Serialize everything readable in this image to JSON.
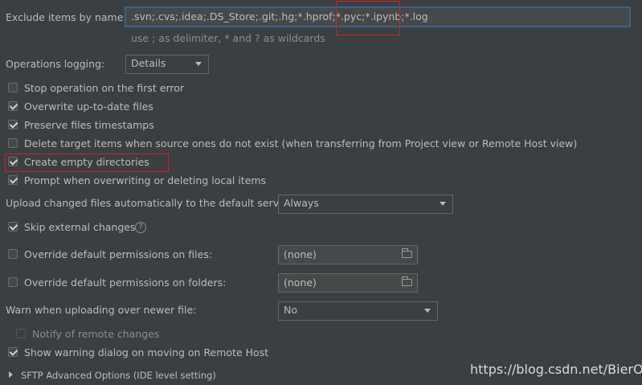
{
  "exclude": {
    "label": "Exclude items by name:",
    "value": ".svn;.cvs;.idea;.DS_Store;.git;.hg;*.hprof;*.pyc;*.ipynb;*.log",
    "hint": "use ; as delimiter, * and ? as wildcards"
  },
  "operations_logging": {
    "label": "Operations logging:",
    "value": "Details"
  },
  "options": {
    "stop_on_error": {
      "label": "Stop operation on the first error",
      "checked": false
    },
    "overwrite_up_to_date": {
      "label": "Overwrite up-to-date files",
      "checked": true
    },
    "preserve_timestamps": {
      "label": "Preserve files timestamps",
      "checked": true
    },
    "delete_target_items": {
      "label": "Delete target items when source ones do not exist (when transferring from Project view or Remote Host view)",
      "checked": false
    },
    "create_empty_dirs": {
      "label": "Create empty directories",
      "checked": true
    },
    "prompt_when_overwriting": {
      "label": "Prompt when overwriting or deleting local items",
      "checked": true
    }
  },
  "upload_changed": {
    "label": "Upload changed files automatically to the default server",
    "value": "Always"
  },
  "skip_external": {
    "label": "Skip external changes",
    "checked": true,
    "help_icon": "?"
  },
  "override_files": {
    "label": "Override default permissions on files:",
    "value": "(none)",
    "checked": false
  },
  "override_folders": {
    "label": "Override default permissions on folders:",
    "value": "(none)",
    "checked": false
  },
  "warn_newer": {
    "label": "Warn when uploading over newer file:",
    "value": "No"
  },
  "notify_remote": {
    "label": "Notify of remote changes",
    "checked": false,
    "enabled": false
  },
  "show_warning_dialog": {
    "label": "Show warning dialog on moving on Remote Host",
    "checked": true
  },
  "sftp_advanced": {
    "label": "SFTP Advanced Options (IDE level setting)"
  },
  "watermark": "https://blog.csdn.net/BierOne",
  "colors": {
    "background": "#3c3f41",
    "text": "#bbbbbb",
    "focus_border": "#3d6185",
    "highlight": "#d0202a"
  }
}
